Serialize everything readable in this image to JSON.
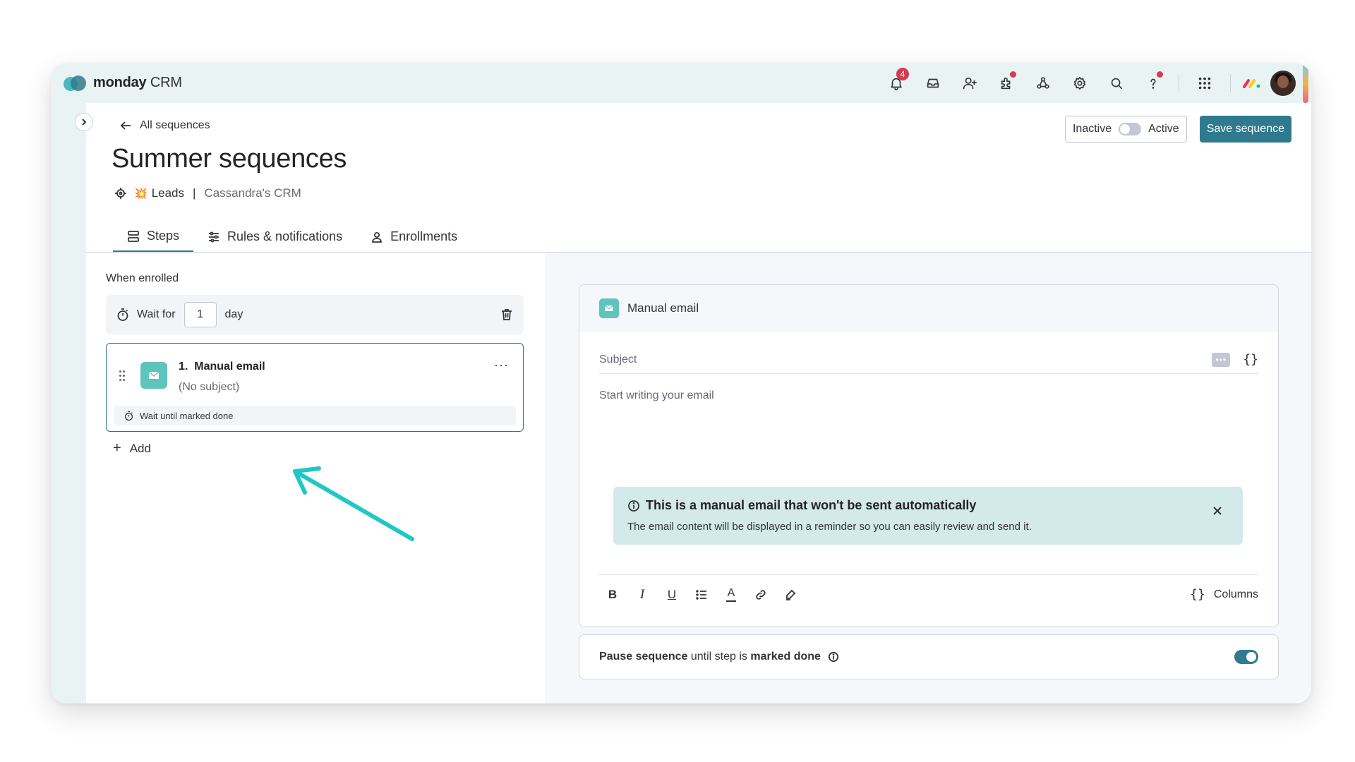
{
  "app": {
    "brand_bold": "monday",
    "brand_light": " CRM"
  },
  "topbar": {
    "notifications_count": "4",
    "icons": [
      "bell-icon",
      "inbox-icon",
      "invite-user-icon",
      "apps-icon",
      "integrations-icon",
      "settings-icon",
      "search-icon",
      "help-icon",
      "grid-icon"
    ]
  },
  "header": {
    "back_label": "All sequences",
    "title": "Summer sequences",
    "board_emoji": "💥",
    "board": "Leads",
    "separator": "|",
    "workspace": "Cassandra's CRM",
    "toggle_off_label": "Inactive",
    "toggle_on_label": "Active",
    "save_label": "Save sequence"
  },
  "tabs": [
    {
      "label": "Steps",
      "active": true
    },
    {
      "label": "Rules & notifications",
      "active": false
    },
    {
      "label": "Enrollments",
      "active": false
    }
  ],
  "steps": {
    "when_enrolled": "When enrolled",
    "wait_prefix": "Wait for",
    "wait_value": "1",
    "wait_unit": "day",
    "step1_number": "1.",
    "step1_title": "Manual email",
    "step1_subject": "(No subject)",
    "step1_wait": "Wait until marked done",
    "step1_more": "···",
    "add_plus": "+",
    "add_label": "Add"
  },
  "email": {
    "header_title": "Manual email",
    "subject_placeholder": "Subject",
    "dots_chip": "•••",
    "braces": "{}",
    "body_placeholder": "Start writing your email",
    "info_title": "This is a manual email that won't be sent automatically",
    "info_desc": "The email content will be displayed in a reminder so you can easily review and send it.",
    "toolbar": {
      "bold": "B",
      "italic": "I",
      "underline": "U",
      "color": "A",
      "columns_label": "Columns"
    }
  },
  "pause": {
    "part1": "Pause sequence",
    "part2": " until step is ",
    "part3": "marked done",
    "enabled": true
  },
  "colors": {
    "accent": "#2f7a8f",
    "email_icon": "#5ec4bc",
    "banner": "#d3e9ea",
    "badge": "#d83a52",
    "arrow": "#1fc7c7"
  }
}
